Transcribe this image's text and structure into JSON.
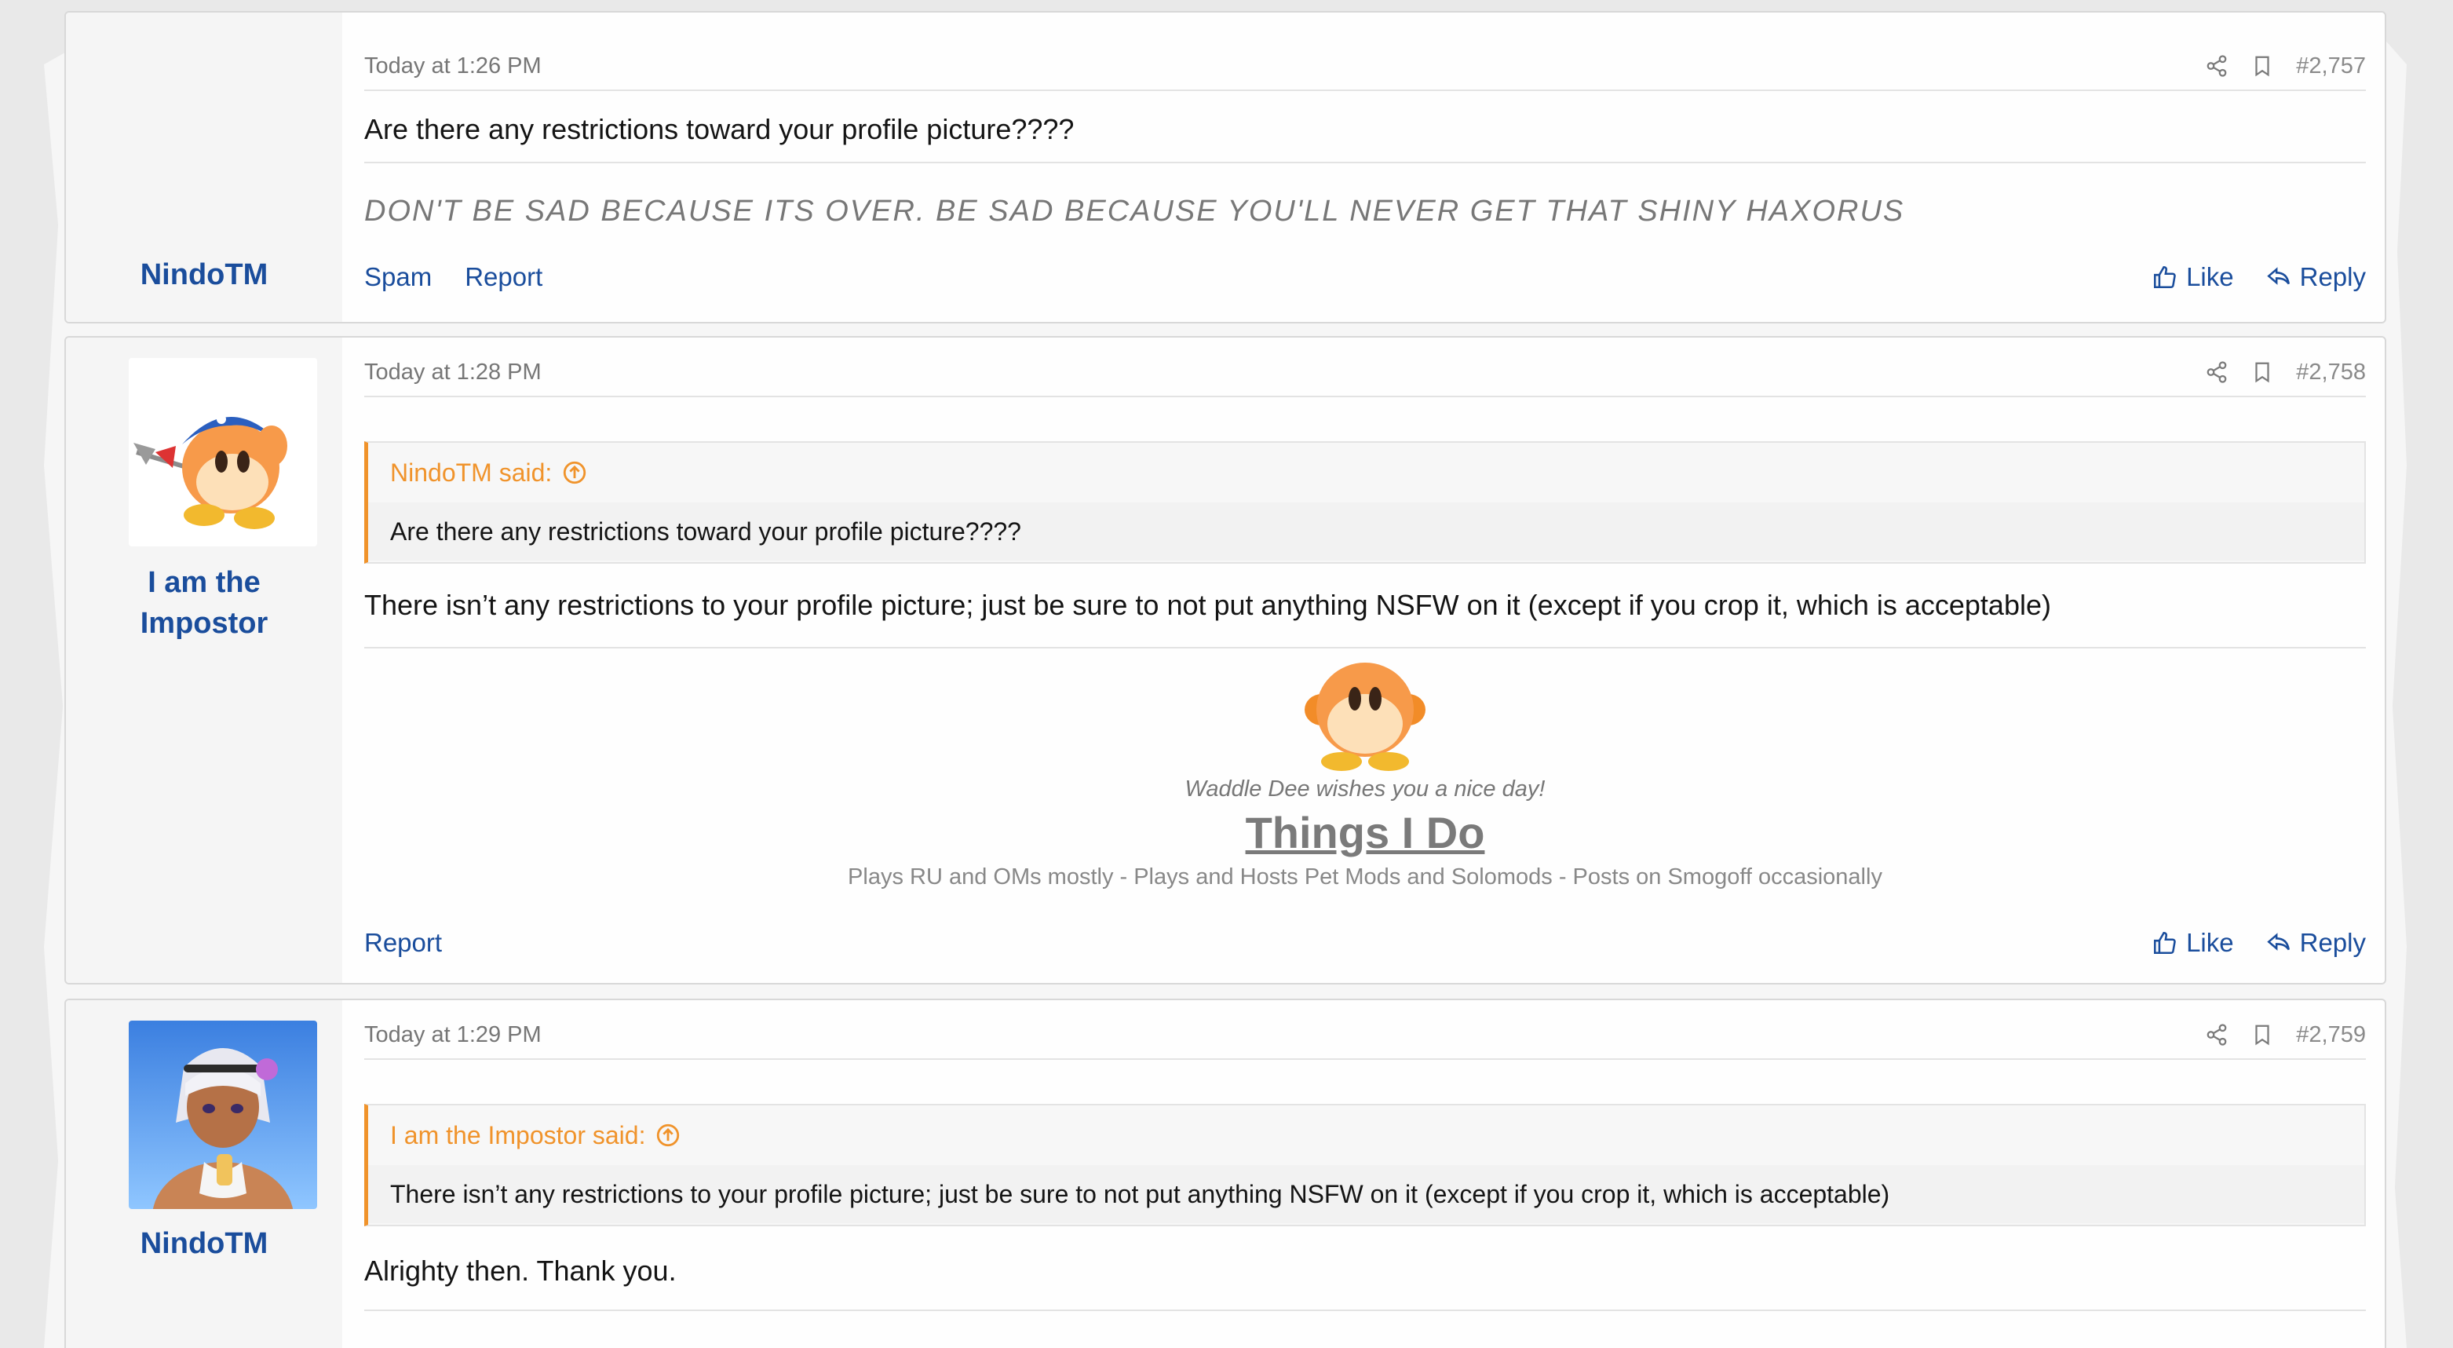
{
  "posts": [
    {
      "username": "NindoTM",
      "date": "Today at 1:26 PM",
      "number": "#2,757",
      "message": "Are there any restrictions toward your profile picture????",
      "signature": "DON'T BE SAD BECAUSE ITS OVER. BE SAD BECAUSE YOU'LL NEVER GET THAT SHINY HAXORUS",
      "left_actions": [
        "Spam",
        "Report"
      ],
      "like_label": "Like",
      "reply_label": "Reply"
    },
    {
      "username_line1": "I am the",
      "username_line2": "Impostor",
      "date": "Today at 1:28 PM",
      "number": "#2,758",
      "quote_author": "NindoTM said:",
      "quote_text": "Are there any restrictions toward your profile picture????",
      "message": "There isn’t any restrictions to your profile picture; just be sure to not put anything NSFW on it (except if you crop it, which is acceptable)",
      "sig_caption": "Waddle Dee wishes you a nice day!",
      "sig_title": "Things I Do",
      "sig_line": "Plays RU and OMs mostly - Plays and Hosts Pet Mods and Solomods - Posts on Smogoff occasionally",
      "left_actions": [
        "Report"
      ],
      "like_label": "Like",
      "reply_label": "Reply"
    },
    {
      "username": "NindoTM",
      "date": "Today at 1:29 PM",
      "number": "#2,759",
      "quote_author": "I am the Impostor said:",
      "quote_text": "There isn’t any restrictions to your profile picture; just be sure to not put anything NSFW on it (except if you crop it, which is acceptable)",
      "message": "Alrighty then. Thank you."
    }
  ],
  "icons": [
    "share-icon",
    "bookmark-icon",
    "thumbs-up-icon",
    "reply-arrow-icon",
    "quote-jump-icon"
  ],
  "colors": {
    "link": "#1a4d9c",
    "quote_accent": "#f0932b",
    "muted": "#767676"
  }
}
